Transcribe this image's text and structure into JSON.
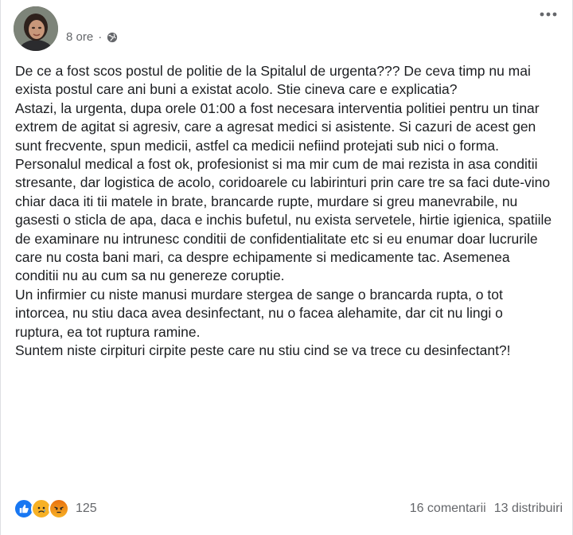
{
  "post": {
    "author": "",
    "time": "8 ore",
    "privacy_icon": "globe-icon",
    "menu_icon": "more-horizontal-icon",
    "paragraphs": [
      "De ce a fost scos postul de politie de la Spitalul de urgenta??? De ceva timp nu mai exista postul care ani buni a existat acolo. Stie cineva care e explicatia?",
      "Astazi, la urgenta, dupa orele 01:00 a fost necesara interventia politiei pentru un tinar extrem de agitat si agresiv, care a agresat medici si asistente. Si cazuri de acest gen sunt frecvente, spun medicii, astfel ca medicii nefiind protejati sub nici o forma.",
      "Personalul medical a fost ok, profesionist si ma mir cum de mai rezista in asa conditii stresante, dar logistica de acolo, coridoarele cu labirinturi prin care tre sa faci dute-vino chiar daca iti tii matele in brate, brancarde rupte, murdare si greu manevrabile, nu gasesti o sticla de apa, daca e inchis bufetul, nu exista servetele, hirtie igienica, spatiile de examinare nu intrunesc conditii de confidentialitate etc si eu enumar doar lucrurile care nu costa bani mari, ca despre echipamente si medicamente tac. Asemenea conditii nu au cum sa nu genereze coruptie.",
      "Un infirmier cu niste manusi murdare stergea de sange o brancarda rupta, o tot intorcea, nu stiu daca avea desinfectant, nu o facea alehamite, dar cit nu lingi o ruptura, ea tot ruptura ramine.",
      "Suntem niste cirpituri cirpite peste care nu stiu cind se va trece cu desinfectant?!"
    ]
  },
  "reactions": {
    "icons": [
      "like-icon",
      "sad-icon",
      "angry-icon"
    ],
    "count": "125"
  },
  "stats": {
    "comments": "16 comentarii",
    "shares": "13 distribuiri"
  },
  "colors": {
    "meta_text": "#65676b",
    "like_blue": "#1877f2",
    "emoji_yellow": "#f7b125"
  }
}
